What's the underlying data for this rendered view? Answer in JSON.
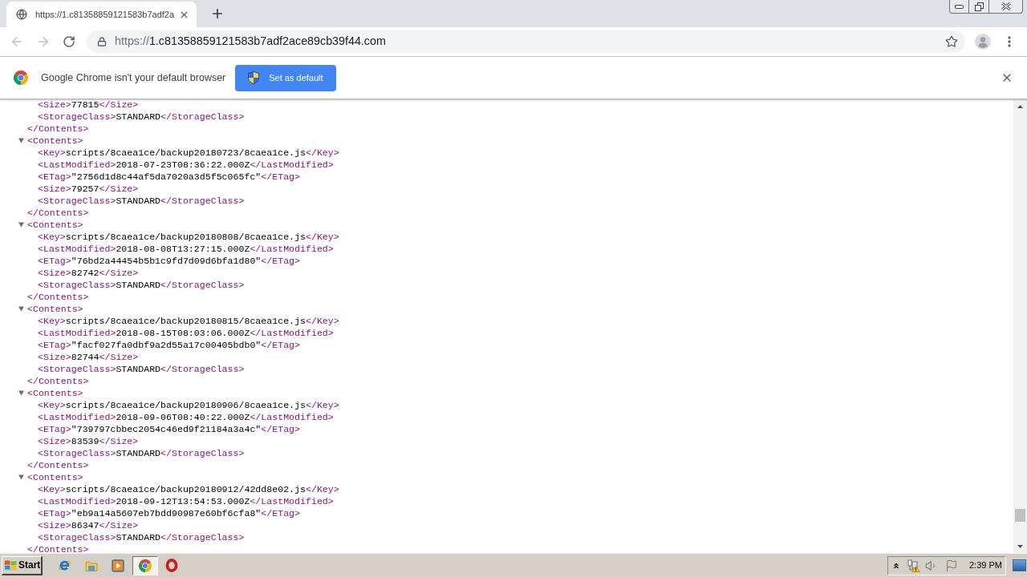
{
  "browser": {
    "tabs": [
      {
        "title": "https://1.c81358859121583b7adf2a",
        "selected": true
      }
    ],
    "nav_buttons": [
      {
        "kind": "back",
        "disabled": true
      },
      {
        "kind": "forward",
        "disabled": true
      },
      {
        "kind": "reload",
        "disabled": false
      }
    ],
    "address_bar": {
      "scheme": "https://",
      "host": "1.c81358859121583b7adf2ace89cb39f44.com"
    },
    "infobar": {
      "message": "Google Chrome isn't your default browser",
      "button": "Set as default"
    }
  },
  "xml_view": {
    "elements": [
      {
        "children": [
          {
            "open_tag": "<Size>",
            "value": "77815",
            "close_tag": "</Size>"
          },
          {
            "open_tag": "<StorageClass>",
            "value": "STANDARD",
            "close_tag": "</StorageClass>"
          }
        ],
        "close_tag": "</Contents>"
      },
      {
        "open_tag": "<Contents>",
        "expanded": true,
        "children": [
          {
            "open_tag": "<Key>",
            "value": "scripts/8caea1ce/backup20180723/8caea1ce.js",
            "close_tag": "</Key>"
          },
          {
            "open_tag": "<LastModified>",
            "value": "2018-07-23T08:36:22.000Z",
            "close_tag": "</LastModified>"
          },
          {
            "open_tag": "<ETag>",
            "value": "\"2756d1d8c44af5da7020a3d5f5c065fc\"",
            "close_tag": "</ETag>"
          },
          {
            "open_tag": "<Size>",
            "value": "79257",
            "close_tag": "</Size>"
          },
          {
            "open_tag": "<StorageClass>",
            "value": "STANDARD",
            "close_tag": "</StorageClass>"
          }
        ],
        "close_tag": "</Contents>"
      },
      {
        "open_tag": "<Contents>",
        "expanded": true,
        "children": [
          {
            "open_tag": "<Key>",
            "value": "scripts/8caea1ce/backup20180808/8caea1ce.js",
            "close_tag": "</Key>"
          },
          {
            "open_tag": "<LastModified>",
            "value": "2018-08-08T13:27:15.000Z",
            "close_tag": "</LastModified>"
          },
          {
            "open_tag": "<ETag>",
            "value": "\"76bd2a44454b5b1c9fd7d09d6bfa1d80\"",
            "close_tag": "</ETag>"
          },
          {
            "open_tag": "<Size>",
            "value": "82742",
            "close_tag": "</Size>"
          },
          {
            "open_tag": "<StorageClass>",
            "value": "STANDARD",
            "close_tag": "</StorageClass>"
          }
        ],
        "close_tag": "</Contents>"
      },
      {
        "open_tag": "<Contents>",
        "expanded": true,
        "children": [
          {
            "open_tag": "<Key>",
            "value": "scripts/8caea1ce/backup20180815/8caea1ce.js",
            "close_tag": "</Key>"
          },
          {
            "open_tag": "<LastModified>",
            "value": "2018-08-15T08:03:06.000Z",
            "close_tag": "</LastModified>"
          },
          {
            "open_tag": "<ETag>",
            "value": "\"facf027fa0dbf9a2d55a17c00405bdb0\"",
            "close_tag": "</ETag>"
          },
          {
            "open_tag": "<Size>",
            "value": "82744",
            "close_tag": "</Size>"
          },
          {
            "open_tag": "<StorageClass>",
            "value": "STANDARD",
            "close_tag": "</StorageClass>"
          }
        ],
        "close_tag": "</Contents>"
      },
      {
        "open_tag": "<Contents>",
        "expanded": true,
        "children": [
          {
            "open_tag": "<Key>",
            "value": "scripts/8caea1ce/backup20180906/8caea1ce.js",
            "close_tag": "</Key>"
          },
          {
            "open_tag": "<LastModified>",
            "value": "2018-09-06T08:40:22.000Z",
            "close_tag": "</LastModified>"
          },
          {
            "open_tag": "<ETag>",
            "value": "\"739797cbbec2054c46ed9f21184a3a4c\"",
            "close_tag": "</ETag>"
          },
          {
            "open_tag": "<Size>",
            "value": "83539",
            "close_tag": "</Size>"
          },
          {
            "open_tag": "<StorageClass>",
            "value": "STANDARD",
            "close_tag": "</StorageClass>"
          }
        ],
        "close_tag": "</Contents>"
      },
      {
        "open_tag": "<Contents>",
        "expanded": true,
        "children": [
          {
            "open_tag": "<Key>",
            "value": "scripts/8caea1ce/backup20180912/42dd8e02.js",
            "close_tag": "</Key>"
          },
          {
            "open_tag": "<LastModified>",
            "value": "2018-09-12T13:54:53.000Z",
            "close_tag": "</LastModified>"
          },
          {
            "open_tag": "<ETag>",
            "value": "\"eb9a14a5607eb7bdd90987e60bf6cfa8\"",
            "close_tag": "</ETag>"
          },
          {
            "open_tag": "<Size>",
            "value": "86347",
            "close_tag": "</Size>"
          },
          {
            "open_tag": "<StorageClass>",
            "value": "STANDARD",
            "close_tag": "</StorageClass>"
          }
        ],
        "close_tag": "</Contents>"
      }
    ]
  },
  "taskbar": {
    "start": "Start",
    "items": [
      {
        "kind": "globe",
        "selected": false
      },
      {
        "kind": "folder",
        "selected": false
      },
      {
        "kind": "player",
        "selected": false
      },
      {
        "kind": "wheel",
        "selected": true
      },
      {
        "kind": "ring",
        "selected": false
      }
    ],
    "clock": "2:39 PM"
  }
}
